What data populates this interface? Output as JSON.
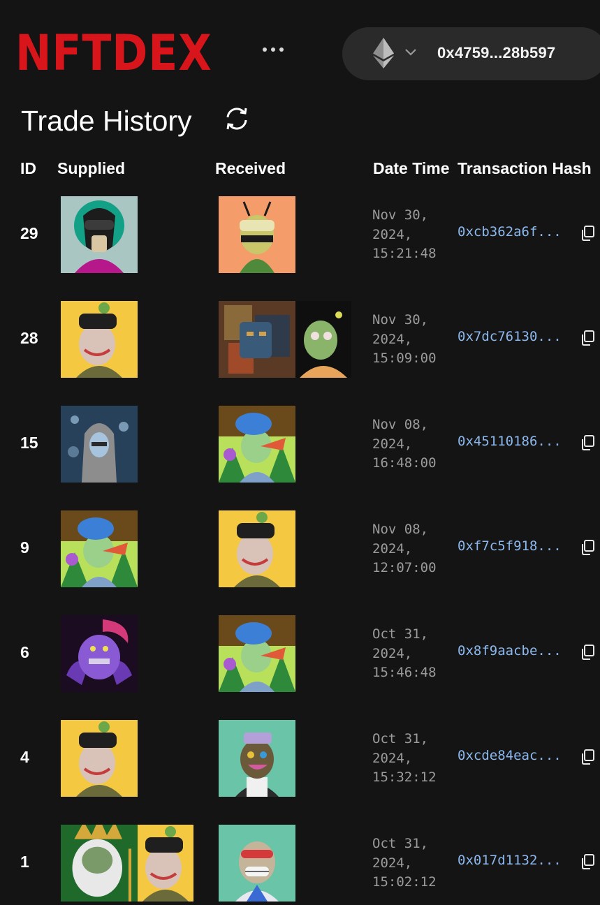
{
  "header": {
    "logo_text": "NFTDEX",
    "wallet_address": "0x4759...28b597",
    "network_icon": "ethereum-icon"
  },
  "page": {
    "title": "Trade History",
    "refresh_icon": "refresh-icon"
  },
  "table": {
    "columns": [
      "ID",
      "Supplied",
      "Received",
      "Date Time",
      "Transaction Hash"
    ],
    "rows": [
      {
        "id": "29",
        "date": "Nov 30,",
        "year": "2024,",
        "time": "15:21:48",
        "hash": "0xcb362a6f...",
        "supplied": [
          "panther-mask"
        ],
        "received": [
          "bug-antenna"
        ]
      },
      {
        "id": "28",
        "date": "Nov 30,",
        "year": "2024,",
        "time": "15:09:00",
        "hash": "0x7dc76130...",
        "supplied": [
          "zombie-ape-yellow"
        ],
        "received": [
          "collage-face",
          "zombie-ape-dark"
        ]
      },
      {
        "id": "15",
        "date": "Nov 08,",
        "year": "2024,",
        "time": "16:48:00",
        "hash": "0x45110186...",
        "supplied": [
          "ghost-girl"
        ],
        "received": [
          "jungle-ape"
        ]
      },
      {
        "id": "9",
        "date": "Nov 08,",
        "year": "2024,",
        "time": "12:07:00",
        "hash": "0xf7c5f918...",
        "supplied": [
          "jungle-ape"
        ],
        "received": [
          "zombie-ape-yellow"
        ]
      },
      {
        "id": "6",
        "date": "Oct 31,",
        "year": "2024,",
        "time": "15:46:48",
        "hash": "0x8f9aacbe...",
        "supplied": [
          "purple-demon"
        ],
        "received": [
          "jungle-ape"
        ]
      },
      {
        "id": "4",
        "date": "Oct 31,",
        "year": "2024,",
        "time": "15:32:12",
        "hash": "0xcde84eac...",
        "supplied": [
          "zombie-ape-yellow"
        ],
        "received": [
          "party-ape"
        ]
      },
      {
        "id": "1",
        "date": "Oct 31,",
        "year": "2024,",
        "time": "15:02:12",
        "hash": "0x017d1132...",
        "supplied": [
          "poseidon-ape",
          "zombie-ape-yellow"
        ],
        "received": [
          "grin-ape"
        ]
      }
    ]
  },
  "colors": {
    "background": "#141414",
    "logo": "#d8151b",
    "hash_link": "#8cb8ee",
    "muted_text": "#9b9b9b",
    "wallet_pill": "#2a2a2a"
  }
}
